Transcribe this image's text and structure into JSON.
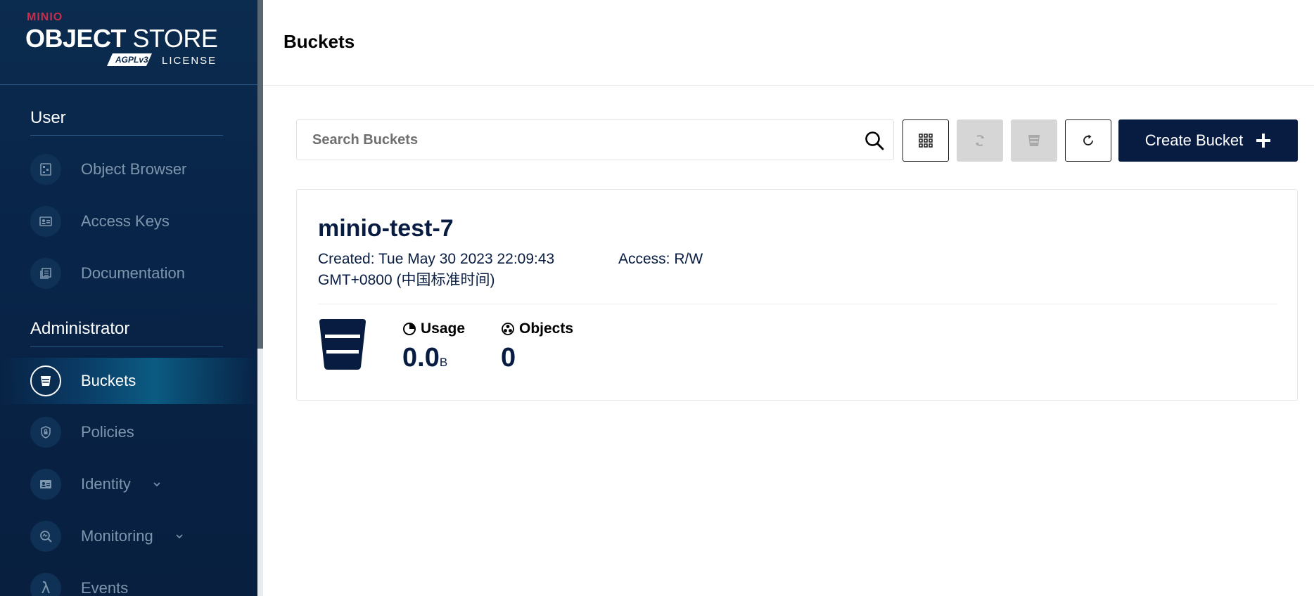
{
  "brand": {
    "company": "MINIO",
    "product_bold": "OBJECT",
    "product_light": "STORE",
    "badge": "AGPLv3",
    "license": "LICENSE"
  },
  "sidebar": {
    "sections": [
      {
        "title": "User",
        "items": [
          {
            "label": "Object Browser",
            "icon": "object-browser-icon"
          },
          {
            "label": "Access Keys",
            "icon": "access-keys-icon"
          },
          {
            "label": "Documentation",
            "icon": "documentation-icon"
          }
        ]
      },
      {
        "title": "Administrator",
        "items": [
          {
            "label": "Buckets",
            "icon": "bucket-icon",
            "active": true
          },
          {
            "label": "Policies",
            "icon": "policies-icon"
          },
          {
            "label": "Identity",
            "icon": "identity-icon",
            "expandable": true
          },
          {
            "label": "Monitoring",
            "icon": "monitoring-icon",
            "expandable": true
          },
          {
            "label": "Events",
            "icon": "lambda-icon"
          }
        ]
      }
    ]
  },
  "header": {
    "title": "Buckets"
  },
  "toolbar": {
    "search_placeholder": "Search Buckets",
    "create_label": "Create Bucket"
  },
  "buckets": [
    {
      "name": "minio-test-7",
      "created": "Created: Tue May 30 2023 22:09:43 GMT+0800 (中国标准时间)",
      "access": "Access: R/W",
      "usage_label": "Usage",
      "usage_value": "0.0",
      "usage_unit": "B",
      "objects_label": "Objects",
      "objects_value": "0"
    }
  ],
  "colors": {
    "sidebar_bg": "#082448",
    "accent": "#081c42",
    "brand_red": "#c72e49"
  }
}
